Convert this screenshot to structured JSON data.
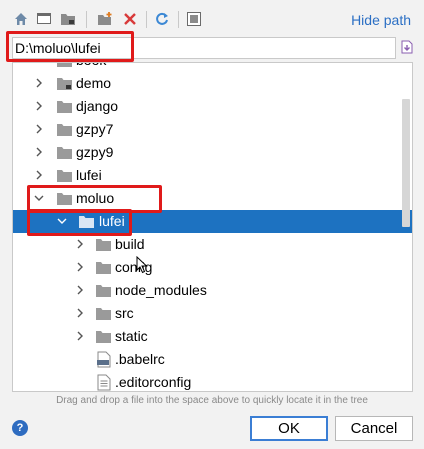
{
  "toolbar": {
    "hide_path_label": "Hide path",
    "icons": [
      "home-icon",
      "desktop-icon",
      "project-folder-icon",
      "new-folder-icon",
      "delete-icon",
      "refresh-icon",
      "show-hidden-icon"
    ]
  },
  "path": {
    "value": "D:\\moluo\\lufei"
  },
  "tree": {
    "items": [
      {
        "label": "book",
        "type": "folder",
        "expanded": false
      },
      {
        "label": "demo",
        "type": "folder",
        "expanded": false
      },
      {
        "label": "django",
        "type": "folder",
        "expanded": false
      },
      {
        "label": "gzpy7",
        "type": "folder",
        "expanded": false
      },
      {
        "label": "gzpy9",
        "type": "folder",
        "expanded": false
      },
      {
        "label": "lufei",
        "type": "folder",
        "expanded": false
      },
      {
        "label": "moluo",
        "type": "folder",
        "expanded": true
      },
      {
        "label": "lufei",
        "type": "folder",
        "expanded": true,
        "selected": true
      },
      {
        "label": "build",
        "type": "folder",
        "expanded": false
      },
      {
        "label": "config",
        "type": "folder",
        "expanded": false
      },
      {
        "label": "node_modules",
        "type": "folder",
        "expanded": false
      },
      {
        "label": "src",
        "type": "folder",
        "expanded": false
      },
      {
        "label": "static",
        "type": "folder",
        "expanded": false
      },
      {
        "label": ".babelrc",
        "type": "json-file"
      },
      {
        "label": ".editorconfig",
        "type": "text-file"
      }
    ]
  },
  "hint": "Drag and drop a file into the space above to quickly locate it in the tree",
  "buttons": {
    "ok": "OK",
    "cancel": "Cancel",
    "help": "?"
  },
  "colors": {
    "selection": "#1d72c1",
    "link": "#2b6fc4",
    "annotation": "#e01a1a"
  }
}
